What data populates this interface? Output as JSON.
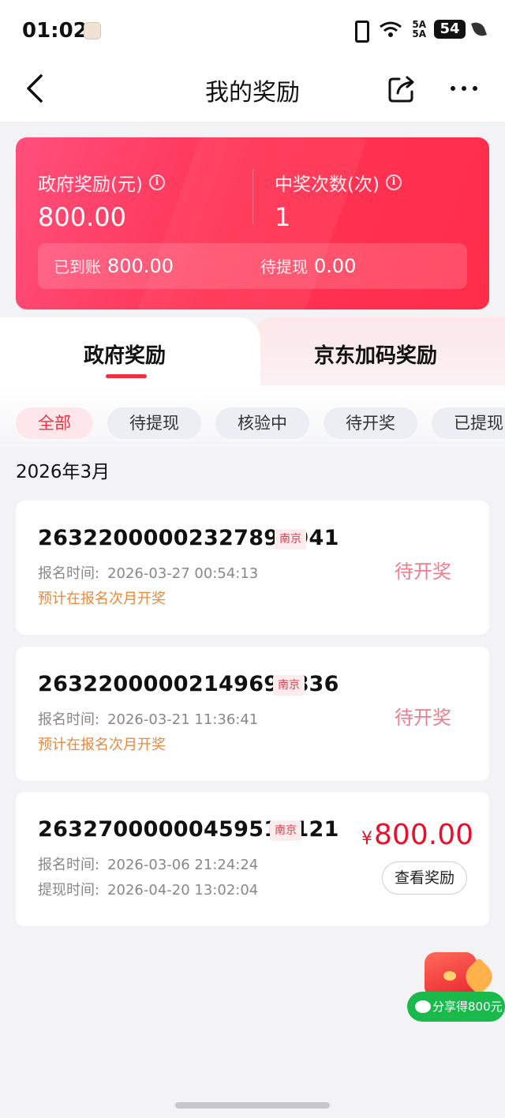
{
  "status_bar": {
    "time": "01:02",
    "network_label": "5A",
    "network_label2": "5A",
    "wifi_label": "6",
    "battery": "54"
  },
  "nav": {
    "title": "我的奖励"
  },
  "summary": {
    "gov_reward_label": "政府奖励(元)",
    "gov_reward_value": "800.00",
    "win_count_label": "中奖次数(次)",
    "win_count_value": "1",
    "received_label": "已到账",
    "received_value": "800.00",
    "pending_label": "待提现",
    "pending_value": "0.00"
  },
  "tabs": [
    {
      "label": "政府奖励",
      "active": true
    },
    {
      "label": "京东加码奖励",
      "active": false
    }
  ],
  "filters": [
    {
      "label": "全部",
      "active": true
    },
    {
      "label": "待提现",
      "active": false
    },
    {
      "label": "核验中",
      "active": false
    },
    {
      "label": "待开奖",
      "active": false
    },
    {
      "label": "已提现",
      "active": false
    }
  ],
  "month": "2026年3月",
  "records": [
    {
      "id": "26322000002327894941",
      "city": "南京",
      "signup_label": "报名时间:",
      "signup_time": "2026-03-27 00:54:13",
      "note": "预计在报名次月开奖",
      "status": "待开奖"
    },
    {
      "id": "26322000002149691836",
      "city": "南京",
      "signup_label": "报名时间:",
      "signup_time": "2026-03-21 11:36:41",
      "note": "预计在报名次月开奖",
      "status": "待开奖"
    },
    {
      "id": "26327000000459519121",
      "city": "南京",
      "signup_label": "报名时间:",
      "signup_time": "2026-03-06 21:24:24",
      "withdraw_label": "提现时间:",
      "withdraw_time": "2026-04-20 13:02:04",
      "currency": "¥",
      "amount": "800.00",
      "view_button": "查看奖励"
    }
  ],
  "float_share": {
    "label": "分享得800元"
  },
  "colors": {
    "accent": "#f0303f",
    "card_gradient_start": "#ff4f7c",
    "card_gradient_end": "#ff2d4a",
    "share_green": "#19b94b"
  }
}
